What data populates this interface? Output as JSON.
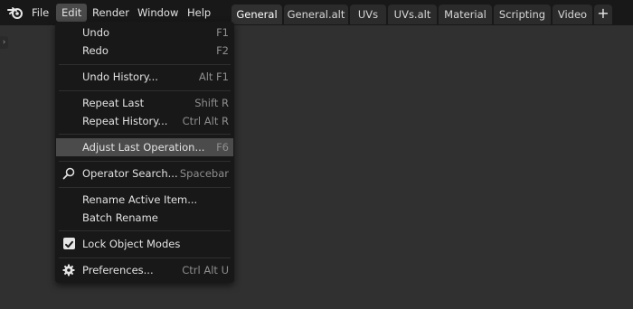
{
  "menubar": {
    "items": [
      {
        "label": "File"
      },
      {
        "label": "Edit"
      },
      {
        "label": "Render"
      },
      {
        "label": "Window"
      },
      {
        "label": "Help"
      }
    ]
  },
  "workspace_tabs": [
    {
      "label": "General"
    },
    {
      "label": "General.alt"
    },
    {
      "label": "UVs"
    },
    {
      "label": "UVs.alt"
    },
    {
      "label": "Material"
    },
    {
      "label": "Scripting"
    },
    {
      "label": "Video"
    },
    {
      "label": "+"
    }
  ],
  "edit_menu": {
    "items": [
      {
        "label": "Undo",
        "shortcut": "F1"
      },
      {
        "label": "Redo",
        "shortcut": "F2"
      },
      {
        "label": "Undo History...",
        "shortcut": "Alt F1"
      },
      {
        "label": "Repeat Last",
        "shortcut": "Shift R"
      },
      {
        "label": "Repeat History...",
        "shortcut": "Ctrl Alt R"
      },
      {
        "label": "Adjust Last Operation...",
        "shortcut": "F6"
      },
      {
        "label": "Operator Search...",
        "shortcut": "Spacebar",
        "icon": "search-icon"
      },
      {
        "label": "Rename Active Item...",
        "shortcut": ""
      },
      {
        "label": "Batch Rename",
        "shortcut": ""
      },
      {
        "label": "Lock Object Modes",
        "shortcut": "",
        "icon": "checkbox-checked-icon",
        "checked": true
      },
      {
        "label": "Preferences...",
        "shortcut": "Ctrl Alt U",
        "icon": "gear-icon"
      }
    ]
  },
  "colors": {
    "menu_bg": "#181818",
    "highlight": "#4b4b4b",
    "viewport_bg": "#303030",
    "shortcut_text": "#8e8e8e"
  }
}
